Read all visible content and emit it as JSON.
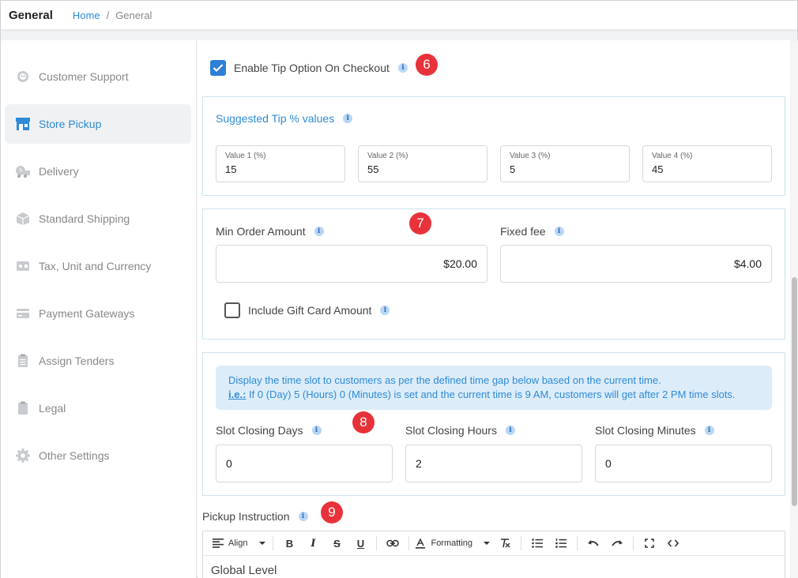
{
  "header": {
    "title": "General",
    "breadcrumb": {
      "home": "Home",
      "separator": "/",
      "current": "General"
    }
  },
  "sidebar": {
    "items": [
      {
        "label": "Customer Support",
        "icon": "headset-icon"
      },
      {
        "label": "Store Pickup",
        "icon": "store-icon",
        "active": true
      },
      {
        "label": "Delivery",
        "icon": "delivery-icon"
      },
      {
        "label": "Standard Shipping",
        "icon": "box-icon"
      },
      {
        "label": "Tax, Unit and Currency",
        "icon": "wallet-icon"
      },
      {
        "label": "Payment Gateways",
        "icon": "card-icon"
      },
      {
        "label": "Assign Tenders",
        "icon": "clipboard-list-icon"
      },
      {
        "label": "Legal",
        "icon": "clipboard-icon"
      },
      {
        "label": "Other Settings",
        "icon": "gear-icon"
      }
    ]
  },
  "tip": {
    "enable_label": "Enable Tip Option On Checkout",
    "enabled": true,
    "badge": "6",
    "suggested_title": "Suggested Tip % values",
    "values": [
      {
        "label": "Value 1 (%)",
        "value": "15"
      },
      {
        "label": "Value 2 (%)",
        "value": "55"
      },
      {
        "label": "Value 3 (%)",
        "value": "5"
      },
      {
        "label": "Value 4 (%)",
        "value": "45"
      }
    ]
  },
  "fees": {
    "badge": "7",
    "min_order_label": "Min Order Amount",
    "min_order_value": "$20.00",
    "fixed_fee_label": "Fixed fee",
    "fixed_fee_value": "$4.00",
    "gift_card_label": "Include Gift Card Amount",
    "gift_card_checked": false
  },
  "slots": {
    "badge": "8",
    "notice_line1": "Display the time slot to customers as per the defined time gap below based on the current time.",
    "notice_ie": "i.e.:",
    "notice_line2": " If 0 (Day) 5 (Hours) 0 (Minutes) is set and the current time is 9 AM, customers will get after 2 PM time slots.",
    "days_label": "Slot Closing Days",
    "days_value": "0",
    "hours_label": "Slot Closing Hours",
    "hours_value": "2",
    "minutes_label": "Slot Closing Minutes",
    "minutes_value": "0"
  },
  "pickup": {
    "badge": "9",
    "label": "Pickup Instruction",
    "toolbar": {
      "align": "Align",
      "formatting": "Formatting"
    },
    "editor_text": "Global Level"
  },
  "info_glyph": "i",
  "colors": {
    "accent": "#2e8bd8",
    "badge": "#e8323a",
    "panel_border": "#c9e4ea"
  }
}
